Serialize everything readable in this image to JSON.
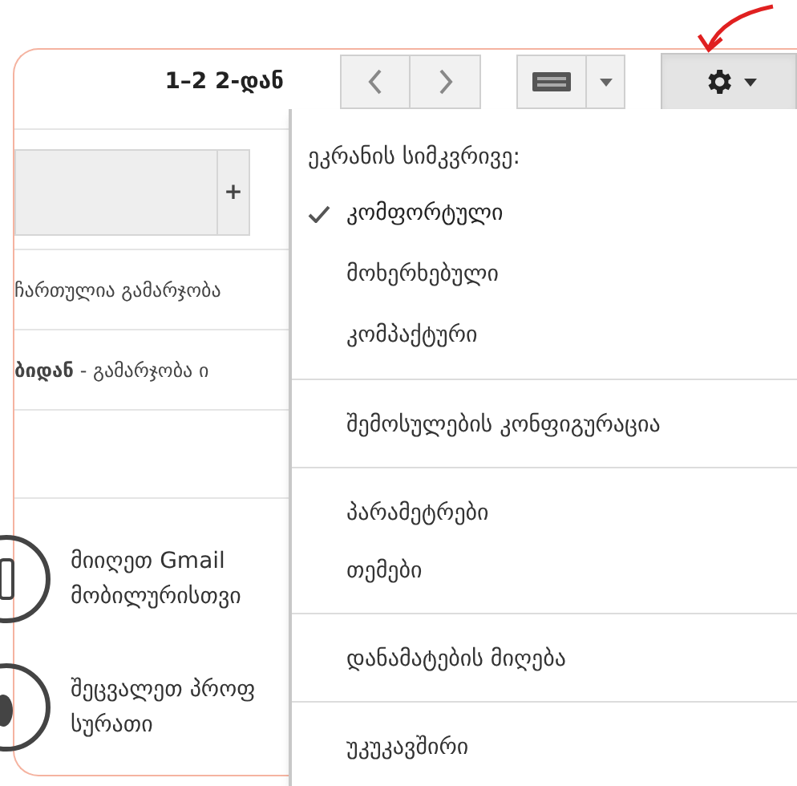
{
  "pagination": {
    "range": "1–2 2-დან"
  },
  "tab_bar": {
    "add_label": "+"
  },
  "messages": [
    {
      "text": "ჩართულია გამარჯობა"
    },
    {
      "text": "**ბიდან** - გამარჯობა ი"
    }
  ],
  "promos": [
    {
      "lines": [
        "მიიღეთ Gmail",
        "მობილურისთვი"
      ]
    },
    {
      "lines": [
        "შეცვალეთ პროფ",
        "სურათი"
      ]
    }
  ],
  "settings_menu": {
    "header": "ეკრანის სიმკვრივე:",
    "density_options": [
      {
        "label": "კომფორტული",
        "selected": true
      },
      {
        "label": "მოხერხებული",
        "selected": false
      },
      {
        "label": "კომპაქტური",
        "selected": false
      }
    ],
    "groups": [
      [
        "შემოსულების კონფიგურაცია"
      ],
      [
        "პარამეტრები",
        "თემები"
      ],
      [
        "დანამატების მიღება"
      ],
      [
        "უკუკავშირი"
      ]
    ]
  }
}
